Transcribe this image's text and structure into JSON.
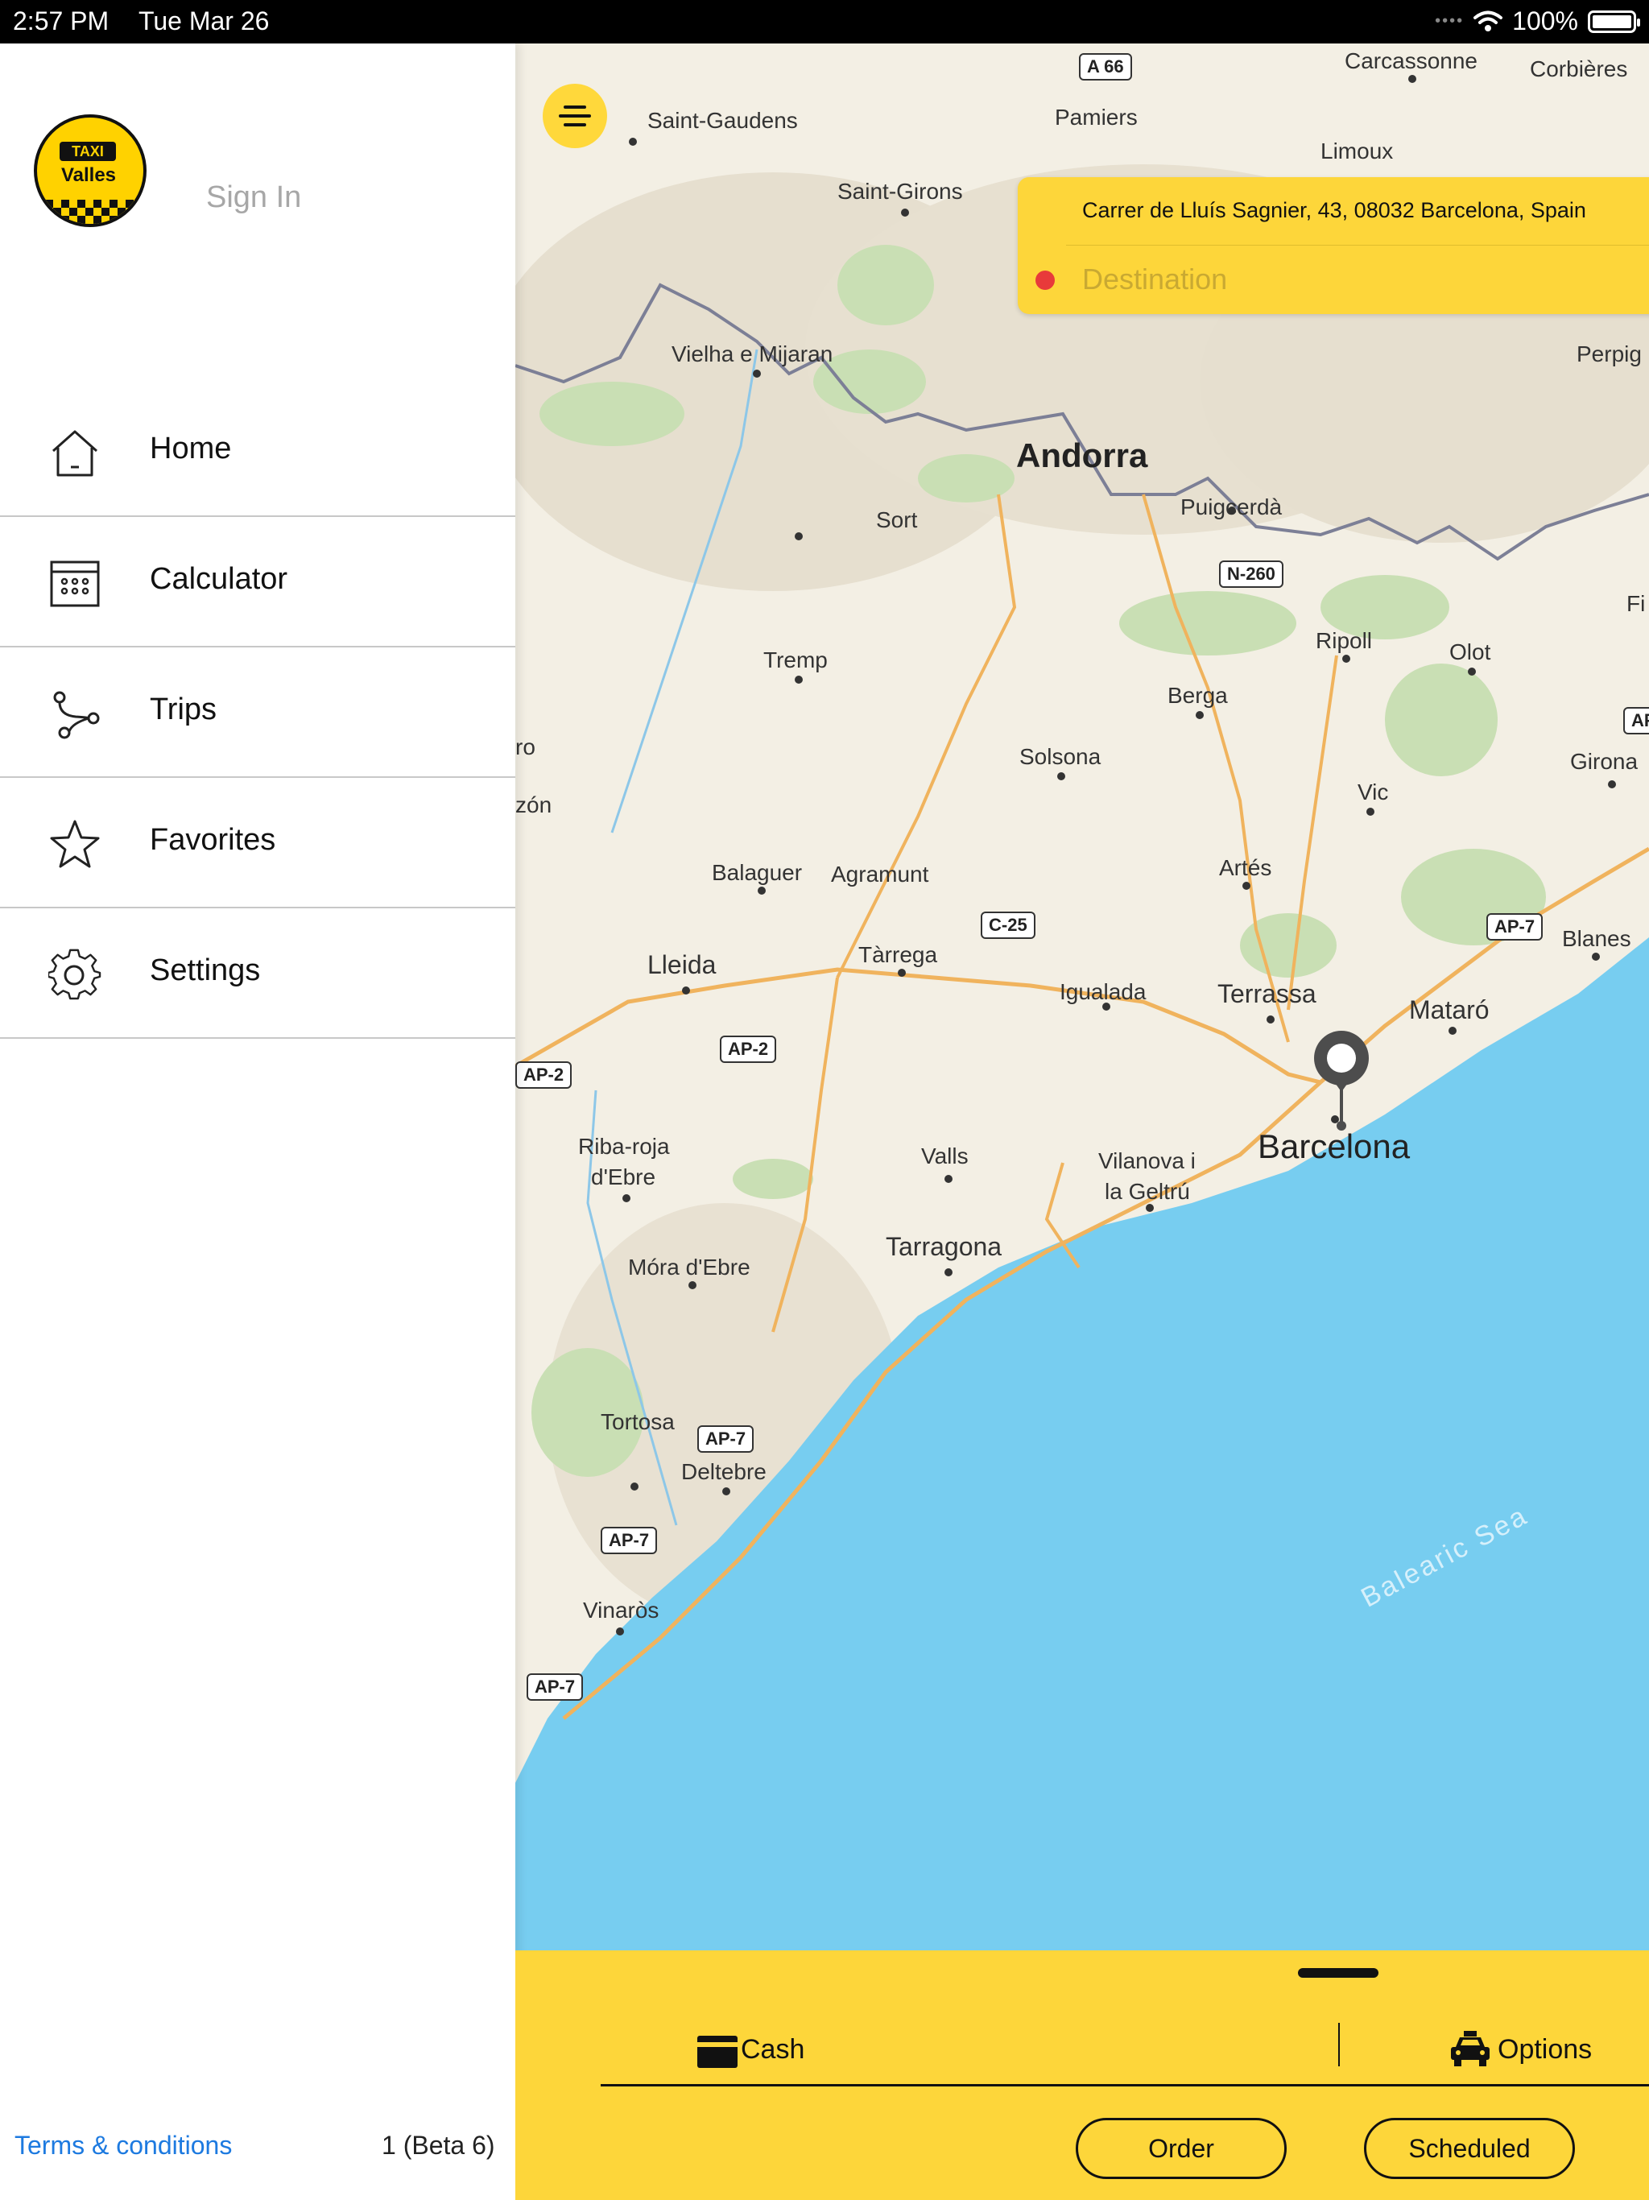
{
  "status_bar": {
    "time": "2:57 PM",
    "date": "Tue Mar 26",
    "battery": "100%",
    "signal_icon": "cellular-dots-icon",
    "wifi_icon": "wifi-icon"
  },
  "sidebar": {
    "logo_text": [
      "TAXI",
      "Valles"
    ],
    "sign_in": "Sign In",
    "items": [
      {
        "label": "Home",
        "icon": "home-icon"
      },
      {
        "label": "Calculator",
        "icon": "calculator-icon"
      },
      {
        "label": "Trips",
        "icon": "trips-icon"
      },
      {
        "label": "Favorites",
        "icon": "star-icon"
      },
      {
        "label": "Settings",
        "icon": "gear-icon"
      }
    ],
    "terms": "Terms & conditions",
    "version": "1 (Beta 6)"
  },
  "map": {
    "places": {
      "carcassonne": "Carcassonne",
      "corbieres": "Corbières",
      "pamiers": "Pamiers",
      "limoux": "Limoux",
      "saint_gaudens": "Saint-Gaudens",
      "saint_girons": "Saint-Girons",
      "vielha": "Vielha e Mijaran",
      "andorra": "Andorra",
      "puigcerda": "Puigcerdà",
      "perpignan": "Perpig",
      "sort": "Sort",
      "tremp": "Tremp",
      "ripoll": "Ripoll",
      "olot": "Olot",
      "berga": "Berga",
      "solsona": "Solsona",
      "vic": "Vic",
      "girona": "Girona",
      "balaguer": "Balaguer",
      "agramunt": "Agramunt",
      "artes": "Artés",
      "lleida": "Lleida",
      "tarrega": "Tàrrega",
      "igualada": "Igualada",
      "terrassa": "Terrassa",
      "blanes": "Blanes",
      "mataro": "Mataró",
      "barcelona": "Barcelona",
      "riba_roja": "Riba-roja",
      "debre": "d'Ebre",
      "valls": "Valls",
      "vilanova": "Vilanova i",
      "geltru": "la Geltrú",
      "tarragona": "Tarragona",
      "mora": "Móra d'Ebre",
      "tortosa": "Tortosa",
      "deltebre": "Deltebre",
      "vinaros": "Vinaròs",
      "balearic": "Balearic Sea",
      "zon": "zón",
      "fi": "Fi",
      "ro": "ro"
    },
    "roads": {
      "a66": "A 66",
      "n260": "N-260",
      "c25": "C-25",
      "ap7_north": "AP-7",
      "ap2_a": "AP-2",
      "ap2_b": "AP-2",
      "ap7_a": "AP-7",
      "ap7_b": "AP-7",
      "ap7_c": "AP-7",
      "ap_edge": "AP"
    }
  },
  "route_panel": {
    "pickup": "Carrer de Lluís Sagnier, 43, 08032 Barcelona, Spain",
    "destination_placeholder": "Destination"
  },
  "bottom_panel": {
    "payment": "Cash",
    "options": "Options",
    "order": "Order",
    "scheduled": "Scheduled"
  },
  "colors": {
    "accent": "#fdd63a",
    "sea": "#77cdf0",
    "land": "#f3efe4",
    "link": "#1d7ae0",
    "destination_dot": "#e83a3a"
  }
}
